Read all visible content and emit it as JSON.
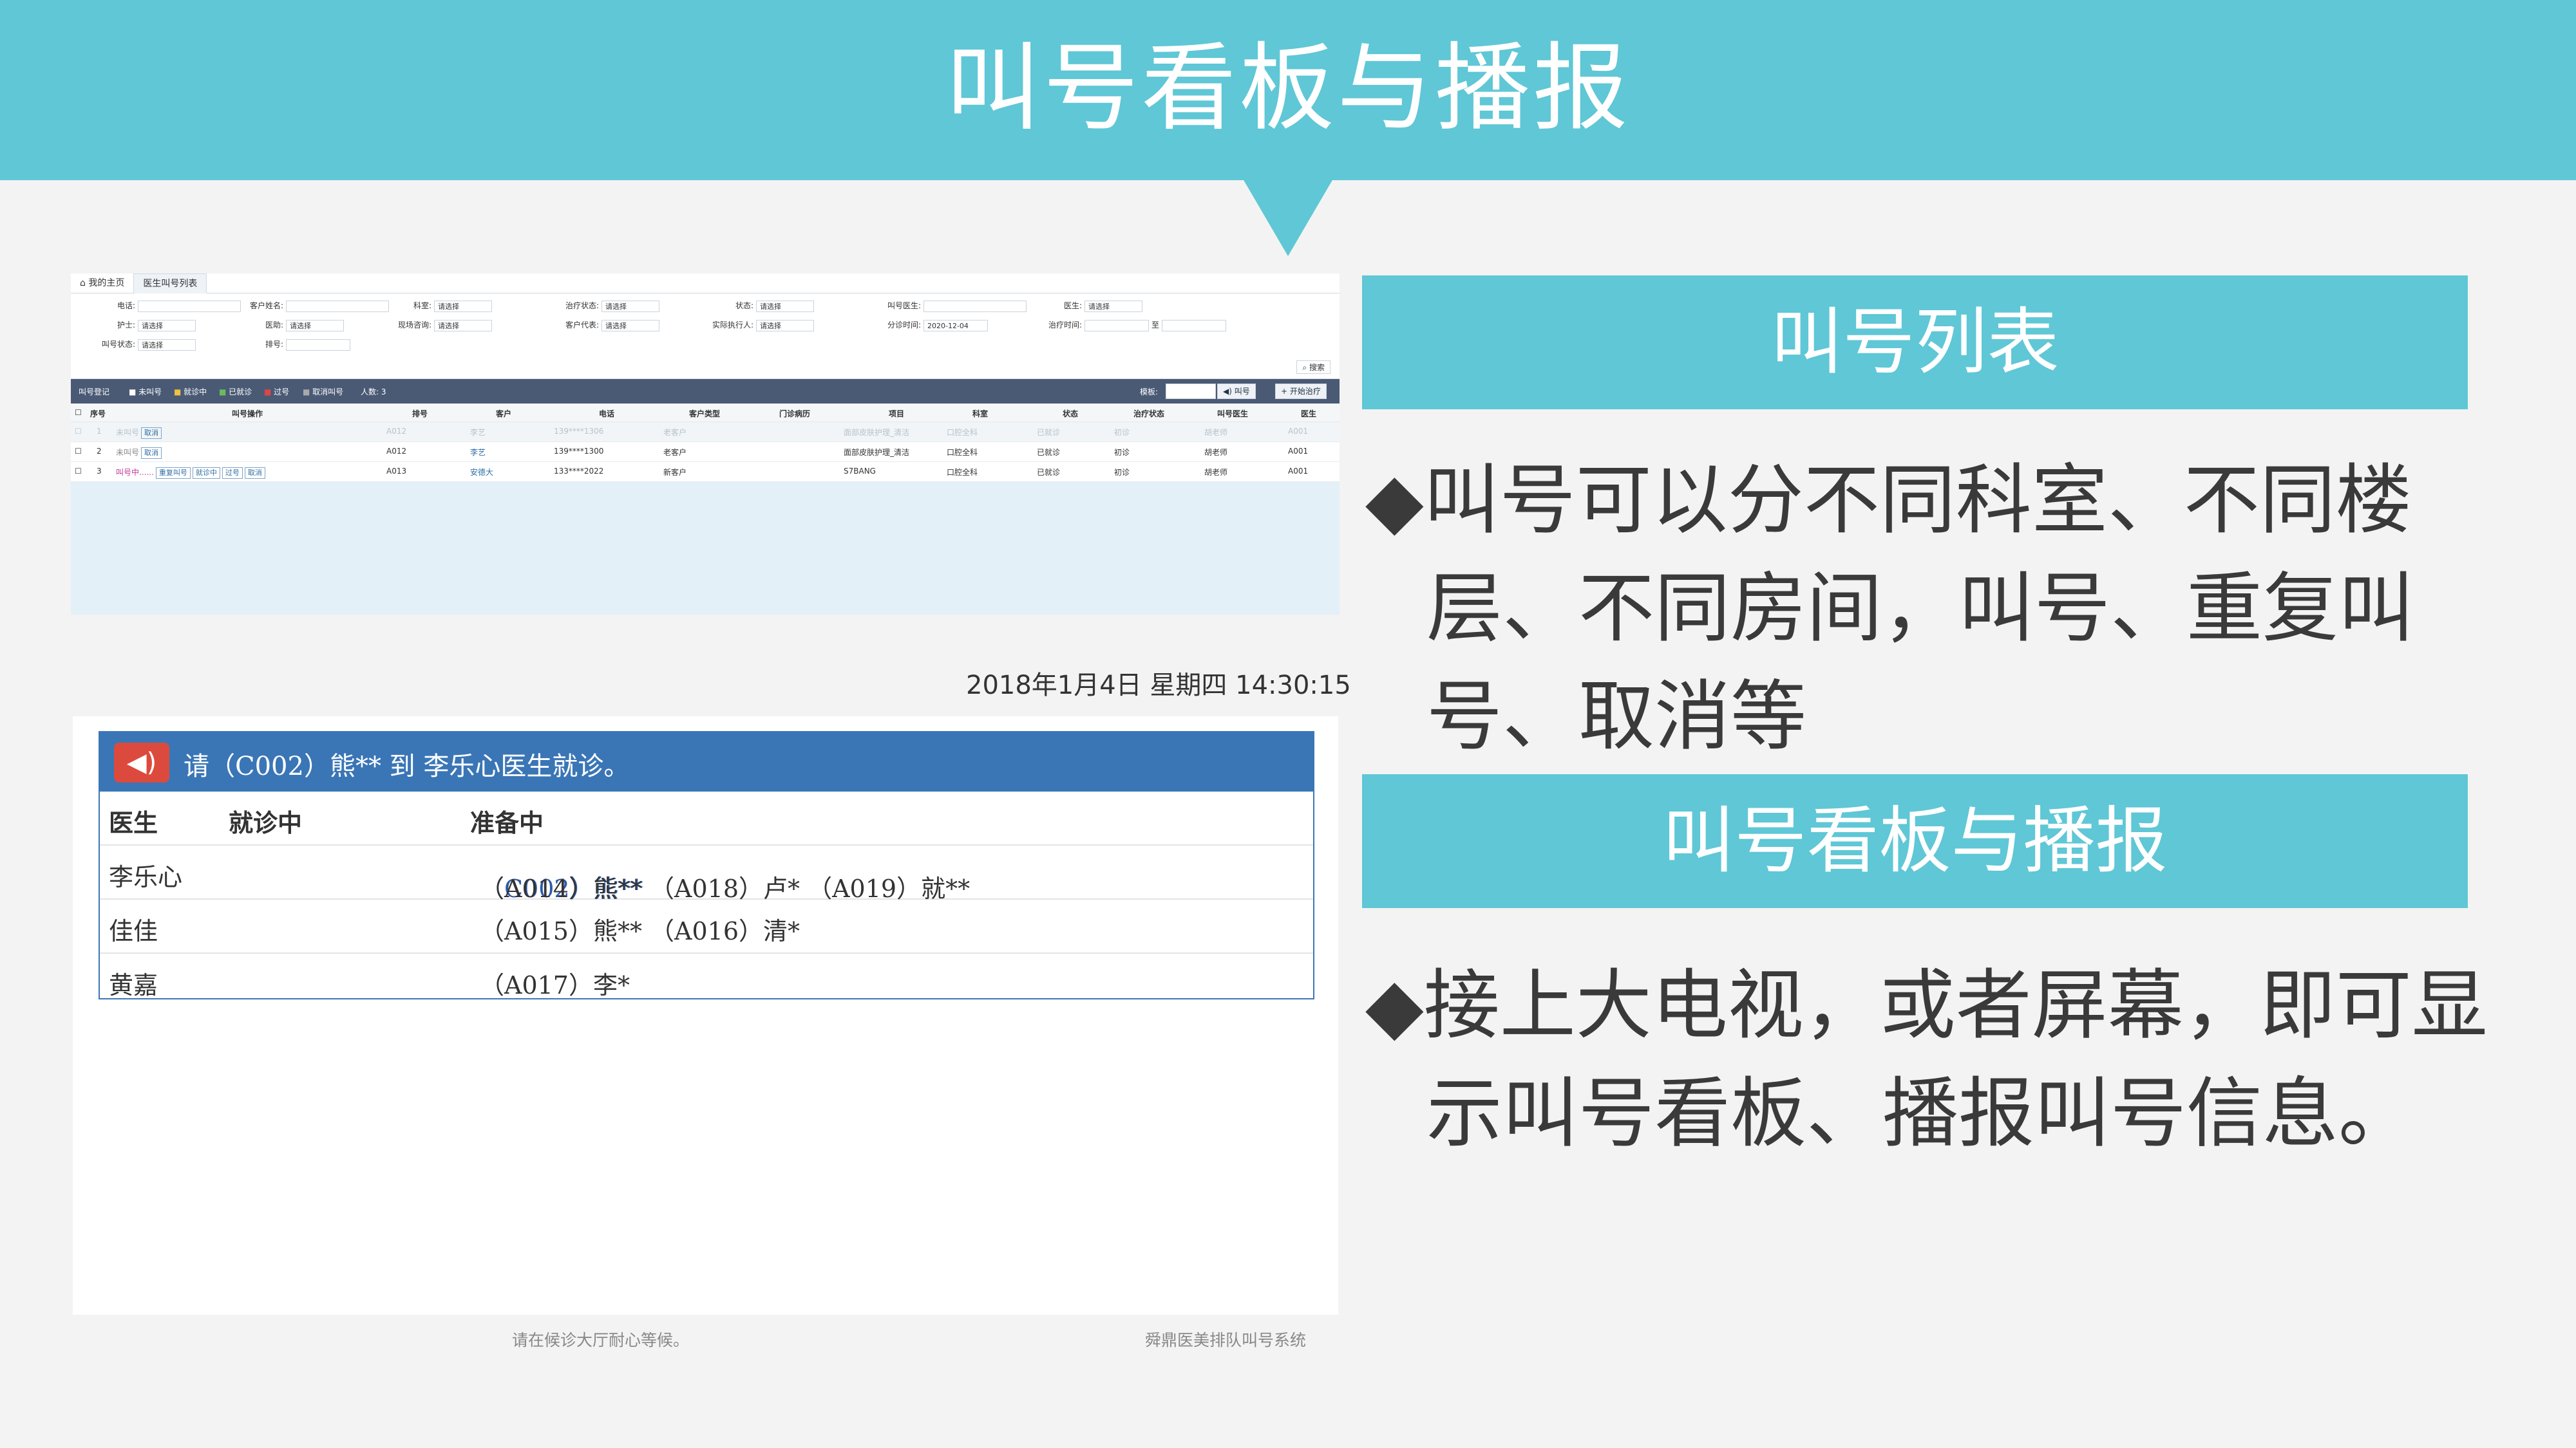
{
  "slide_title": "叫号看板与播报",
  "screenshot_list": {
    "tabs": [
      "我的主页",
      "医生叫号列表"
    ],
    "filters": {
      "phone": "电话:",
      "customer_name": "客户姓名:",
      "department": "科室:",
      "department_value": "请选择",
      "treat_status": "治疗状态:",
      "treat_status_value": "请选择",
      "status": "状态:",
      "status_value": "请选择",
      "caller_doctor": "叫号医生:",
      "doctor": "医生:",
      "doctor_value": "请选择",
      "nurse": "护士:",
      "nurse_value": "请选择",
      "consultant": "医助:",
      "consultant_value": "请选择",
      "current_consultant": "现场咨询:",
      "current_consultant_value": "请选择",
      "customer_rep": "客户代表:",
      "customer_rep_value": "请选择",
      "actual_executor": "实际执行人:",
      "actual_executor_value": "请选择",
      "triage_time": "分诊时间:",
      "triage_time_value": "2020-12-04",
      "treat_time": "治疗时间:",
      "to": "至",
      "call_status": "叫号状态:",
      "call_status_value": "请选择",
      "queue_no": "排号:",
      "search_btn": "搜索"
    },
    "toolbar": {
      "register": "叫号登记",
      "not_called": "未叫号",
      "in_visit": "就诊中",
      "visited": "已就诊",
      "passed": "过号",
      "cancelled": "取消叫号",
      "count": "人数: 3",
      "template": "模板:",
      "call_btn": "叫号",
      "start_treat_btn": "开始治疗"
    },
    "columns": [
      "序号",
      "叫号操作",
      "排号",
      "客户",
      "电话",
      "客户类型",
      "门诊病历",
      "项目",
      "科室",
      "状态",
      "治疗状态",
      "叫号医生",
      "医生"
    ],
    "rows": [
      {
        "no": "1",
        "op_status": "未叫号",
        "btns": [
          "取消"
        ],
        "queue": "A012",
        "customer": "李艺",
        "phone": "139****1306",
        "ctype": "老客户",
        "record": "",
        "project": "面部皮肤护理_清洁",
        "dept": "口腔全科",
        "state": "已就诊",
        "treat": "初诊",
        "caller": "胡老师",
        "doctor": "A001"
      },
      {
        "no": "2",
        "op_status": "未叫号",
        "btns": [
          "取消"
        ],
        "queue": "A012",
        "customer": "李艺",
        "phone": "139****1300",
        "ctype": "老客户",
        "record": "",
        "project": "面部皮肤护理_清洁",
        "dept": "口腔全科",
        "state": "已就诊",
        "treat": "初诊",
        "caller": "胡老师",
        "doctor": "A001"
      },
      {
        "no": "3",
        "op_status": "叫号中......",
        "btns": [
          "重复叫号",
          "就诊中",
          "过号",
          "取消"
        ],
        "queue": "A013",
        "customer": "安德大",
        "phone": "133****2022",
        "ctype": "新客户",
        "record": "",
        "project": "S7BANG",
        "dept": "口腔全科",
        "state": "已就诊",
        "treat": "初诊",
        "caller": "胡老师",
        "doctor": "A001"
      }
    ]
  },
  "board": {
    "datetime": "2018年1月4日 星期四 14:30:15",
    "speaker_icon": "speaker-icon",
    "call_message": "请（C002）熊** 到 李乐心医生就诊。",
    "headers": {
      "doctor": "医生",
      "in_visit": "就诊中",
      "waiting": "准备中"
    },
    "rows": [
      {
        "doctor": "李乐心",
        "in_visit": "",
        "waiting_highlight": "（C002）熊**",
        "waiting": "（A014）熊**  （A018）卢*  （A019）就**"
      },
      {
        "doctor": "佳佳",
        "in_visit": "",
        "waiting_highlight": "",
        "waiting": "（A015）熊**  （A016）清*"
      },
      {
        "doctor": "黄嘉",
        "in_visit": "",
        "waiting_highlight": "",
        "waiting": "（A017）李*"
      }
    ],
    "footer_left": "请在候诊大厅耐心等候。",
    "footer_right": "舜鼎医美排队叫号系统"
  },
  "right": {
    "section1_title": "叫号列表",
    "bullet1_line1": "◆叫号可以分不同科室、不同楼",
    "bullet1_line2": "层、不同房间，叫号、重复叫",
    "bullet1_line3": "号、取消等",
    "section2_title": "叫号看板与播报",
    "bullet2_line1": "◆接上大电视，或者屏幕，即可显",
    "bullet2_line2": "示叫号看板、播报叫号信息。"
  },
  "colors": {
    "accent": "#5fc7d6",
    "panel_blue": "#3a76b6",
    "speaker_red": "#dc4a3e"
  }
}
